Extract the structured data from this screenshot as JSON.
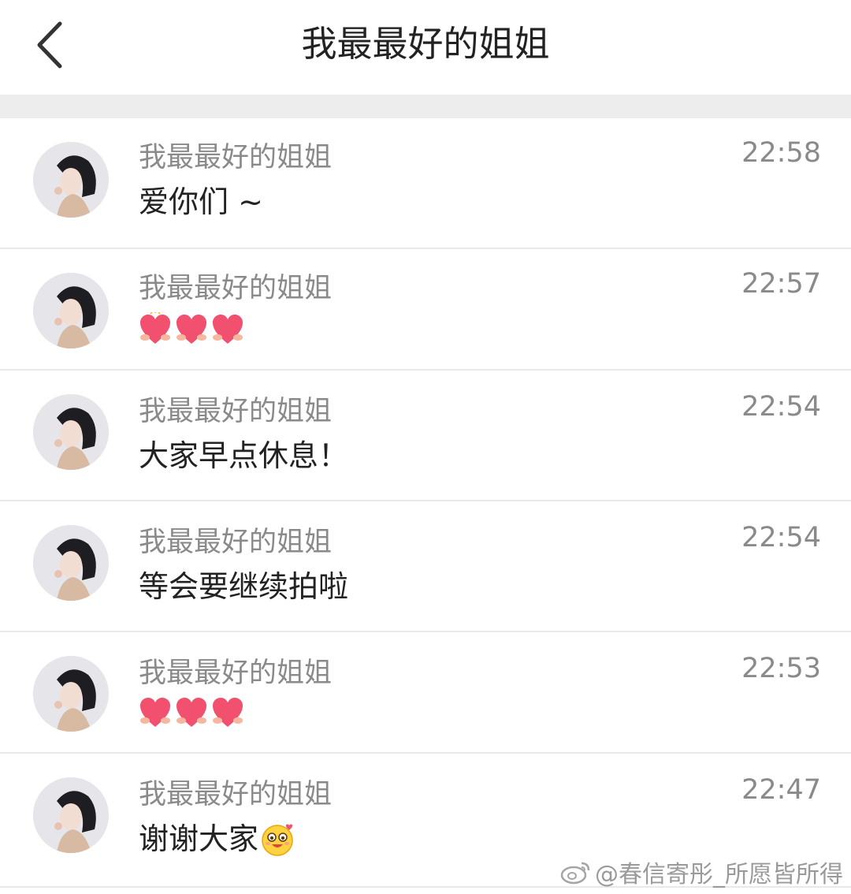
{
  "header": {
    "title": "我最最好的姐姐"
  },
  "messages": [
    {
      "sender": "我最最好的姐姐",
      "time": "22:58",
      "text": "爱你们 ~",
      "emojis": []
    },
    {
      "sender": "我最最好的姐姐",
      "time": "22:57",
      "text": "",
      "emojis": [
        "heart-hug-emoji",
        "heart-hug-emoji",
        "heart-hug-emoji"
      ]
    },
    {
      "sender": "我最最好的姐姐",
      "time": "22:54",
      "text": "大家早点休息！",
      "emojis": []
    },
    {
      "sender": "我最最好的姐姐",
      "time": "22:54",
      "text": "等会要继续拍啦",
      "emojis": []
    },
    {
      "sender": "我最最好的姐姐",
      "time": "22:53",
      "text": "",
      "emojis": [
        "heart-hug-emoji",
        "heart-hug-emoji",
        "heart-hug-emoji"
      ]
    },
    {
      "sender": "我最最好的姐姐",
      "time": "22:47",
      "text": "谢谢大家",
      "emojis": [
        "cute-happy-face-emoji"
      ]
    }
  ],
  "watermark": {
    "text": "@春信寄彤_所愿皆所得"
  },
  "colors": {
    "divider_band": "#ededed",
    "secondary_text": "#8a8a8a",
    "primary_text": "#222222",
    "heart": "#f2506f"
  }
}
